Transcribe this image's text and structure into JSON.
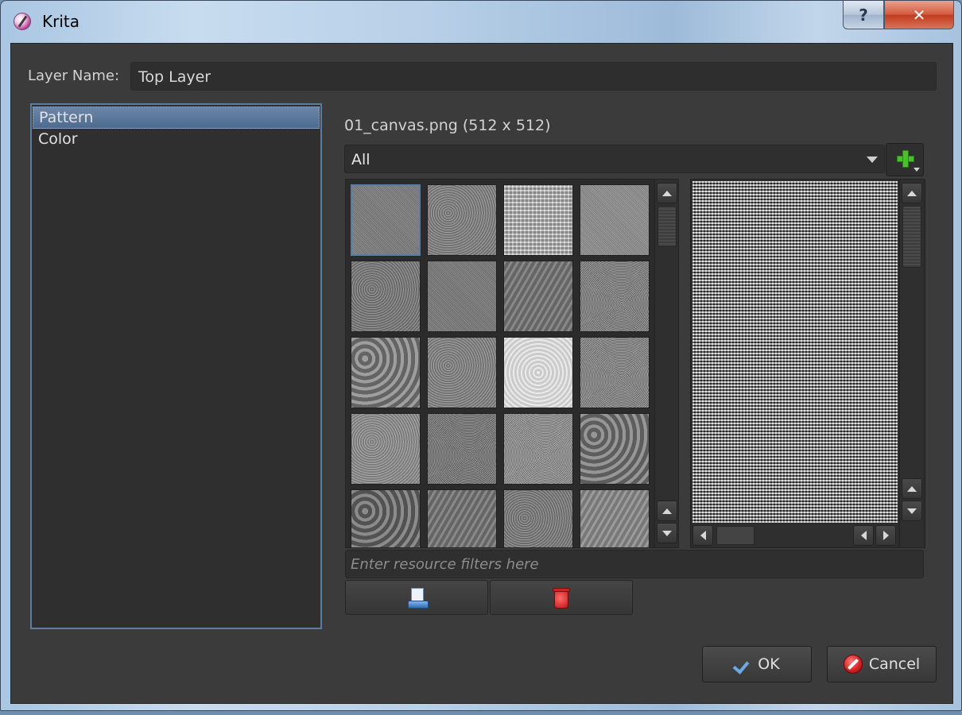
{
  "window": {
    "title": "Krita",
    "help_label": "?",
    "close_label": "✕"
  },
  "layer_name": {
    "label": "Layer Name:",
    "value": "Top Layer"
  },
  "fill_types": {
    "items": [
      {
        "label": "Pattern",
        "selected": true
      },
      {
        "label": "Color",
        "selected": false
      }
    ]
  },
  "pattern": {
    "current_file": "01_canvas.png (512 x 512)",
    "tag_filter": "All",
    "filter_placeholder": "Enter resource filters here",
    "swatches": [
      {
        "tone": "#7d7d7d",
        "texture": "fine"
      },
      {
        "tone": "#8a8a8a",
        "texture": "noise"
      },
      {
        "tone": "#b8b8b8",
        "texture": "checker"
      },
      {
        "tone": "#8e8e8e",
        "texture": "fine"
      },
      {
        "tone": "#818181",
        "texture": "noise"
      },
      {
        "tone": "#7a7a7a",
        "texture": "fine"
      },
      {
        "tone": "#777777",
        "texture": "stripes"
      },
      {
        "tone": "#8a8a8a",
        "texture": "speckle"
      },
      {
        "tone": "#868686",
        "texture": "bumpy"
      },
      {
        "tone": "#8c8c8c",
        "texture": "noise"
      },
      {
        "tone": "#dcdcdc",
        "texture": "light"
      },
      {
        "tone": "#8f8f8f",
        "texture": "speckle"
      },
      {
        "tone": "#979797",
        "texture": "noise"
      },
      {
        "tone": "#7f7f7f",
        "texture": "speckle"
      },
      {
        "tone": "#9a9a9a",
        "texture": "speckle"
      },
      {
        "tone": "#7c7c7c",
        "texture": "bumpy"
      },
      {
        "tone": "#6e6e6e",
        "texture": "bumpy"
      },
      {
        "tone": "#777777",
        "texture": "stripes"
      },
      {
        "tone": "#848484",
        "texture": "noise"
      },
      {
        "tone": "#8d8d8d",
        "texture": "stripes"
      }
    ],
    "selected_index": 0
  },
  "buttons": {
    "ok": "OK",
    "cancel": "Cancel"
  },
  "icons": {
    "app": "krita-icon",
    "add": "add-resource-icon",
    "import": "import-resource-icon",
    "delete": "delete-resource-icon",
    "ok": "checkmark-icon",
    "cancel": "cancel-icon"
  },
  "colors": {
    "selection": "#5b7da3",
    "add_green": "#49c12d",
    "delete_red": "#c41616"
  }
}
